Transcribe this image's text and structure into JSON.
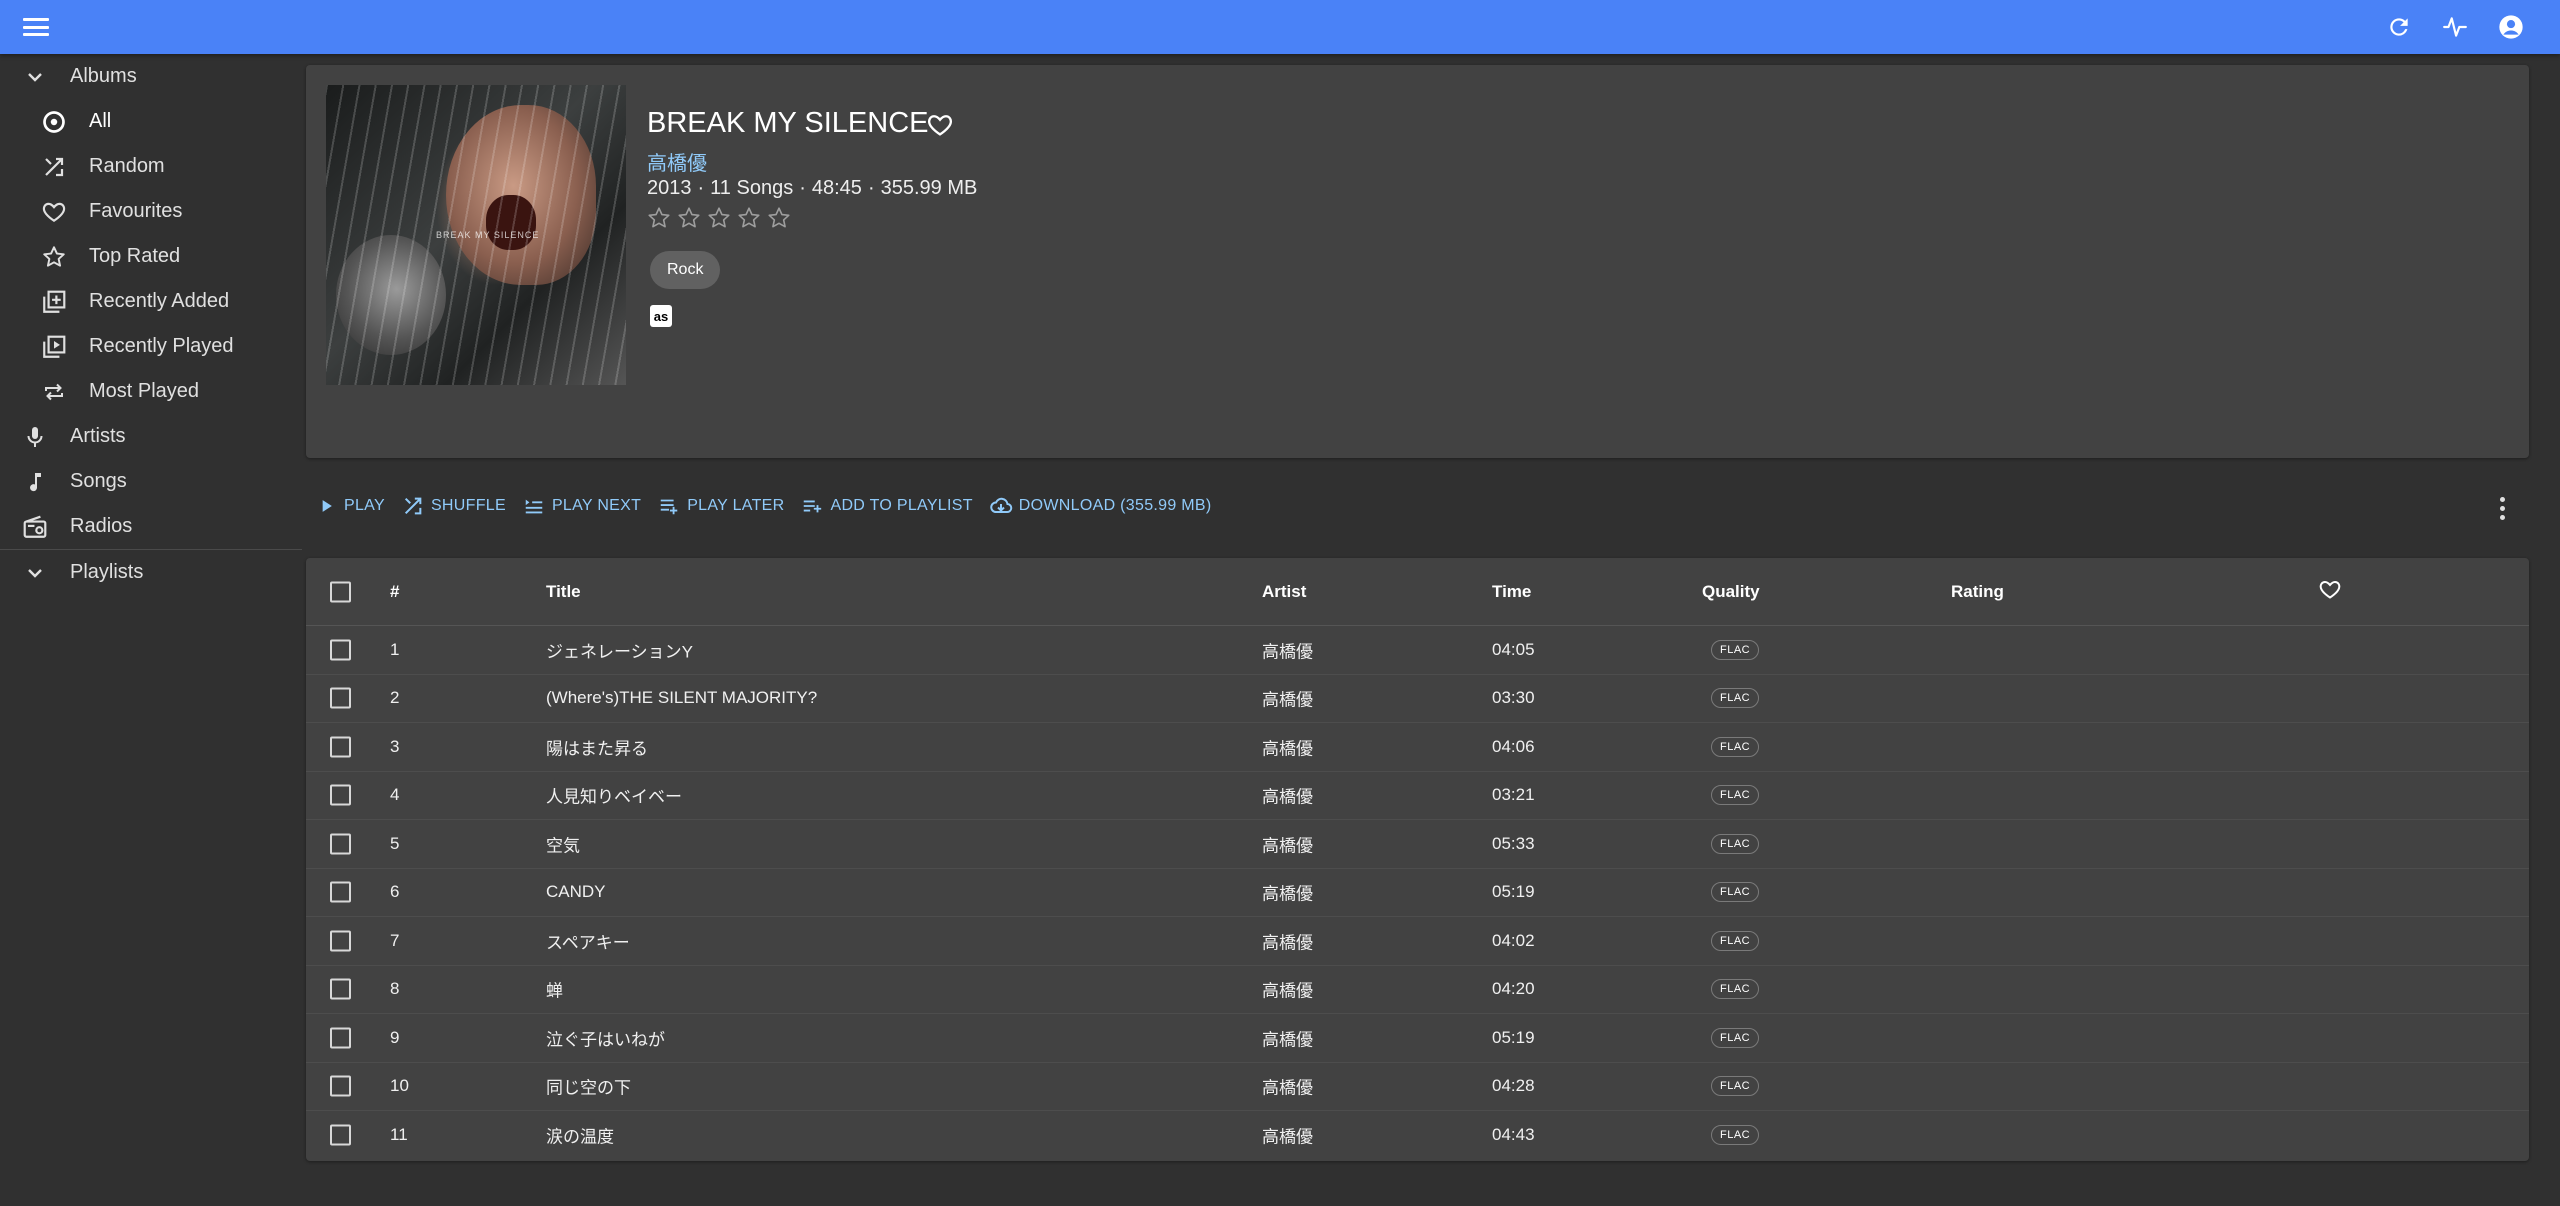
{
  "appbar": {
    "icons": [
      "menu-icon",
      "refresh-icon",
      "activity-icon",
      "account-icon"
    ]
  },
  "sidebar": {
    "albums_label": "Albums",
    "album_items": [
      {
        "label": "All",
        "icon": "disc-icon"
      },
      {
        "label": "Random",
        "icon": "shuffle-icon"
      },
      {
        "label": "Favourites",
        "icon": "heart-icon"
      },
      {
        "label": "Top Rated",
        "icon": "star-icon"
      },
      {
        "label": "Recently Added",
        "icon": "library-add-icon"
      },
      {
        "label": "Recently Played",
        "icon": "video-library-icon"
      },
      {
        "label": "Most Played",
        "icon": "repeat-icon"
      }
    ],
    "artists_label": "Artists",
    "songs_label": "Songs",
    "radios_label": "Radios",
    "playlists_label": "Playlists"
  },
  "album": {
    "title": "BREAK MY SILENCE",
    "artist": "高橋優",
    "year": "2013",
    "songs": "11 Songs",
    "duration": "48:45",
    "size": "355.99 MB",
    "rating": 0,
    "genre": "Rock",
    "lastfm_label": "as",
    "cover_text": "BREAK MY SILENCE"
  },
  "toolbar": {
    "play": "PLAY",
    "shuffle": "SHUFFLE",
    "play_next": "PLAY NEXT",
    "play_later": "PLAY LATER",
    "add_to_playlist": "ADD TO PLAYLIST",
    "download": "DOWNLOAD (355.99 MB)"
  },
  "table": {
    "headers": {
      "num": "#",
      "title": "Title",
      "artist": "Artist",
      "time": "Time",
      "quality": "Quality",
      "rating": "Rating"
    },
    "rows": [
      {
        "num": "1",
        "title": "ジェネレーションY",
        "artist": "高橋優",
        "time": "04:05",
        "quality": "FLAC"
      },
      {
        "num": "2",
        "title": "(Where's)THE SILENT MAJORITY?",
        "artist": "高橋優",
        "time": "03:30",
        "quality": "FLAC"
      },
      {
        "num": "3",
        "title": "陽はまた昇る",
        "artist": "高橋優",
        "time": "04:06",
        "quality": "FLAC"
      },
      {
        "num": "4",
        "title": "人見知りベイベー",
        "artist": "高橋優",
        "time": "03:21",
        "quality": "FLAC"
      },
      {
        "num": "5",
        "title": "空気",
        "artist": "高橋優",
        "time": "05:33",
        "quality": "FLAC"
      },
      {
        "num": "6",
        "title": "CANDY",
        "artist": "高橋優",
        "time": "05:19",
        "quality": "FLAC"
      },
      {
        "num": "7",
        "title": "スペアキー",
        "artist": "高橋優",
        "time": "04:02",
        "quality": "FLAC"
      },
      {
        "num": "8",
        "title": "蝉",
        "artist": "高橋優",
        "time": "04:20",
        "quality": "FLAC"
      },
      {
        "num": "9",
        "title": "泣ぐ子はいねが",
        "artist": "高橋優",
        "time": "05:19",
        "quality": "FLAC"
      },
      {
        "num": "10",
        "title": "同じ空の下",
        "artist": "高橋優",
        "time": "04:28",
        "quality": "FLAC"
      },
      {
        "num": "11",
        "title": "涙の温度",
        "artist": "高橋優",
        "time": "04:43",
        "quality": "FLAC"
      }
    ]
  },
  "colors": {
    "appbar": "#4a82f7",
    "background": "#303030",
    "card": "#424242",
    "accent_link": "#90caf9"
  }
}
